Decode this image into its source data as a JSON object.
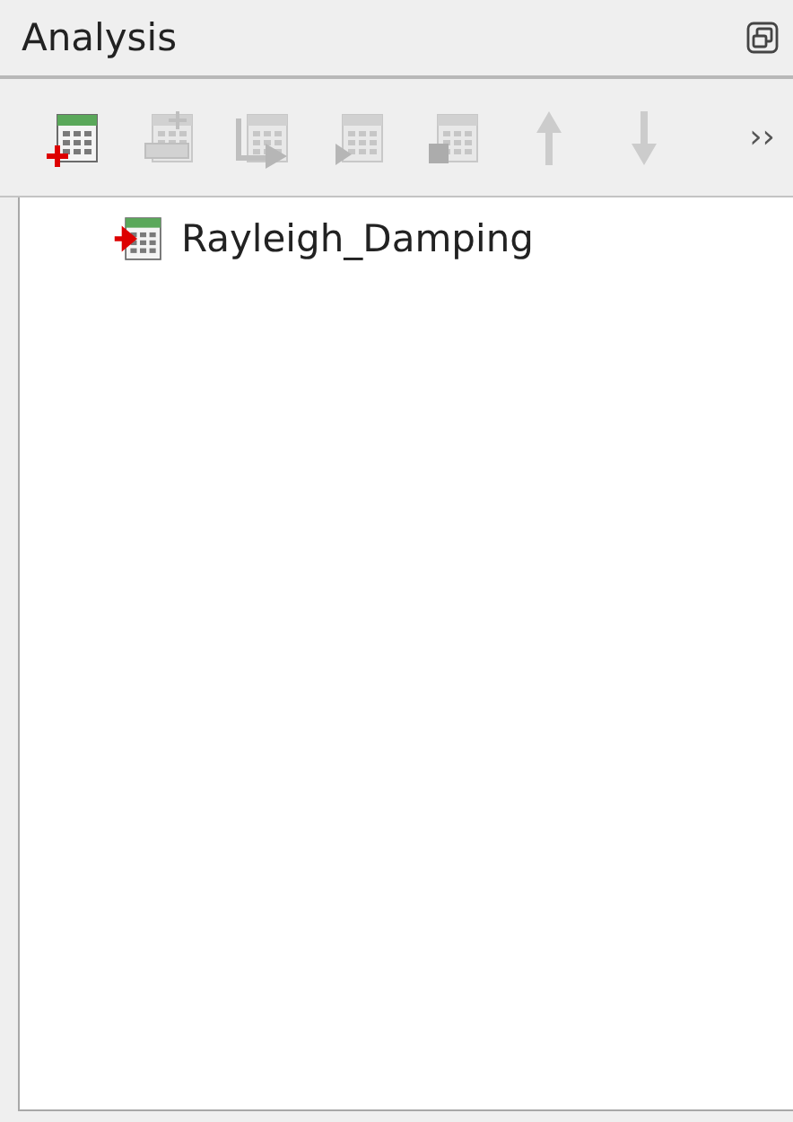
{
  "panel": {
    "title": "Analysis"
  },
  "toolbar": {
    "tools": [
      {
        "kind": "add",
        "disabled": false
      },
      {
        "kind": "insert",
        "disabled": true
      },
      {
        "kind": "move",
        "disabled": true
      },
      {
        "kind": "play",
        "disabled": true
      },
      {
        "kind": "stop",
        "disabled": true
      },
      {
        "kind": "up",
        "disabled": true
      },
      {
        "kind": "down",
        "disabled": true
      }
    ],
    "overflow": "››"
  },
  "tree": {
    "items": [
      {
        "label": "Rayleigh_Damping",
        "selected": false
      }
    ]
  }
}
